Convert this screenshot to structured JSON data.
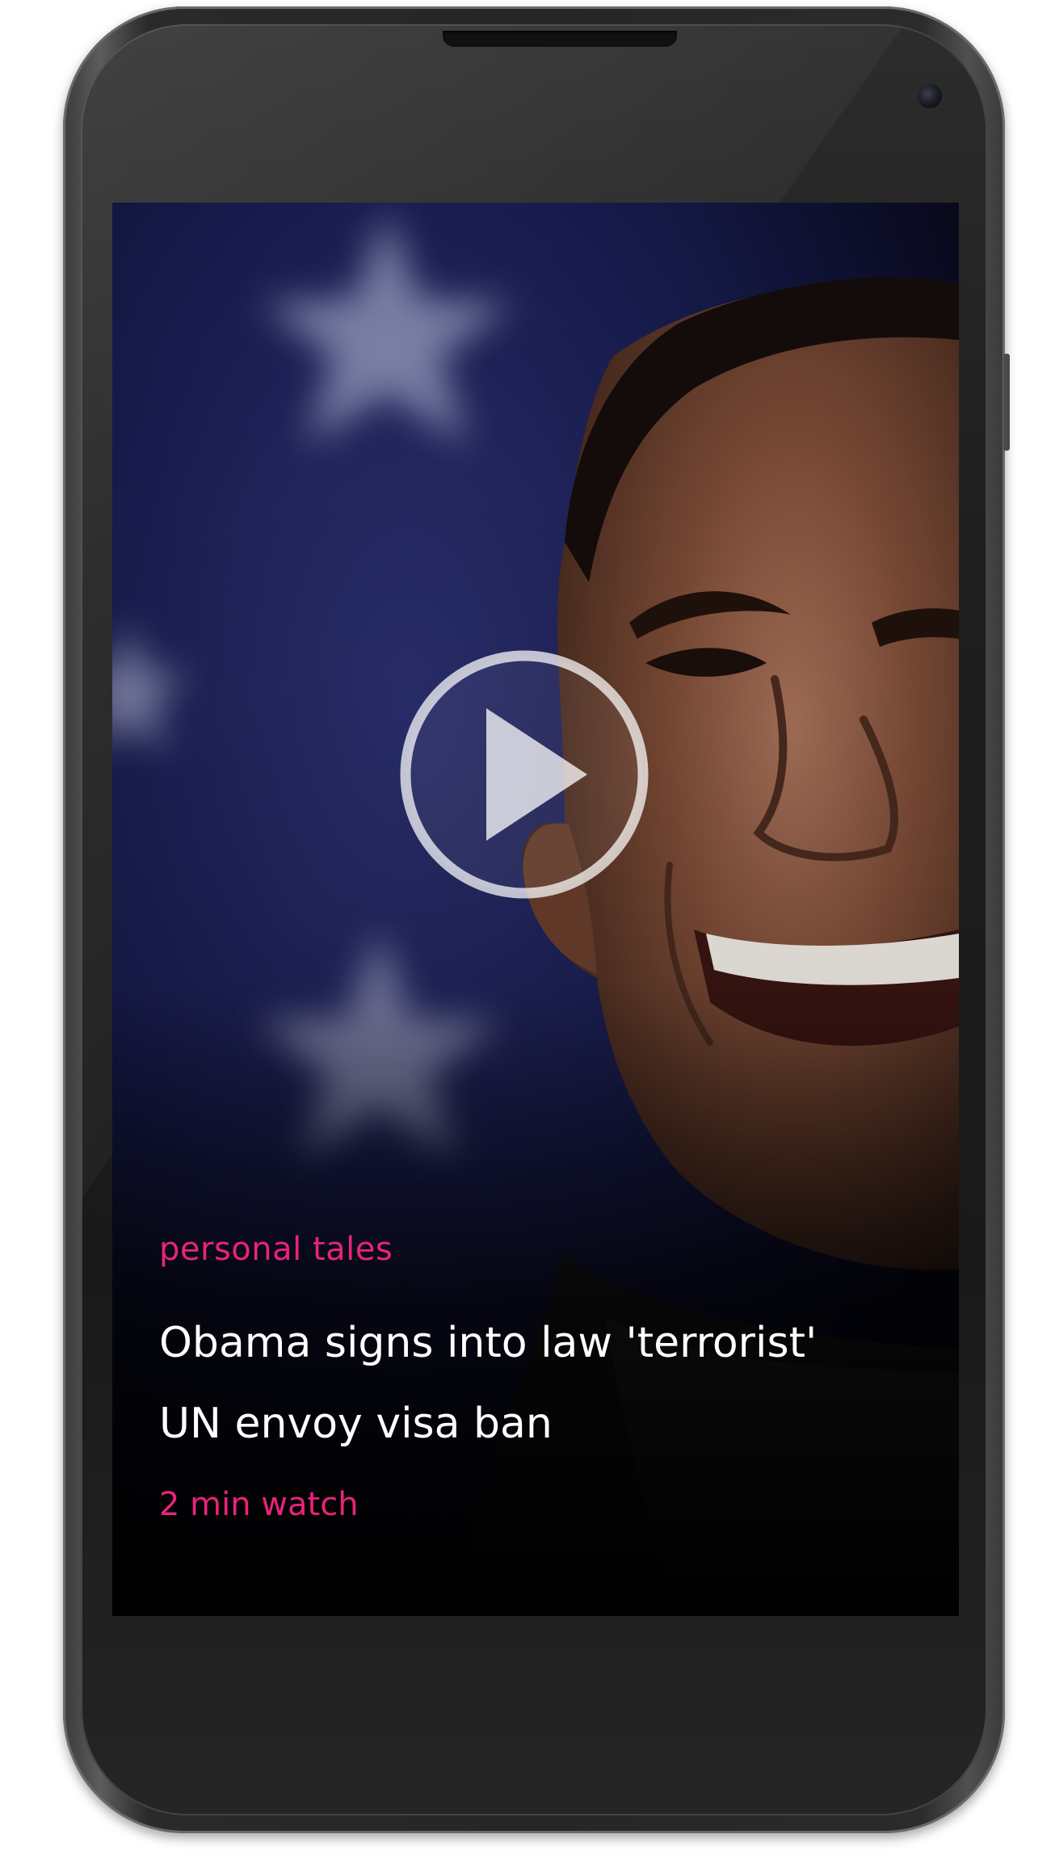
{
  "story": {
    "category": "personal tales",
    "headline_line1": "Obama signs into law 'terrorist'",
    "headline_line2": "UN envoy visa ban",
    "duration": "2 min watch"
  },
  "icons": {
    "play": "play-icon"
  },
  "colors": {
    "accent": "#e8237a",
    "headline": "#ffffff",
    "phone_body": "#262626"
  }
}
